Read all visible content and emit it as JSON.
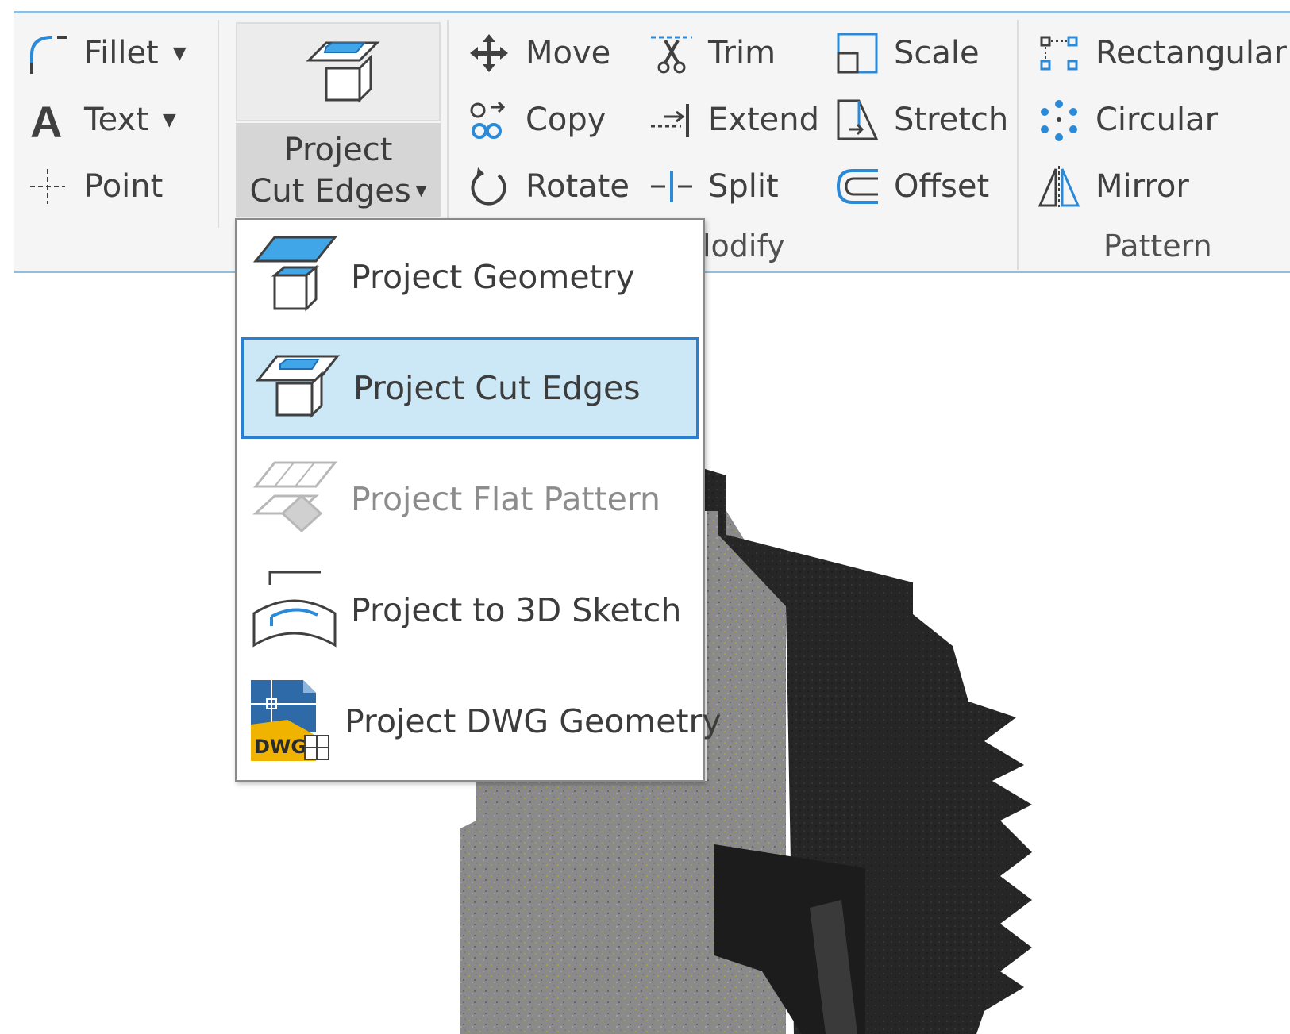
{
  "colors": {
    "accent": "#2b7fd0",
    "selected_bg": "#cce8f6",
    "ribbon_bg": "#f5f5f5",
    "disabled_text": "#8c8c8c",
    "dwg_yellow": "#f0b400",
    "dwg_blue": "#2f6aa8"
  },
  "draw_group": {
    "fillet_label": "Fillet",
    "text_label": "Text",
    "point_label": "Point"
  },
  "project_split": {
    "label_line1": "Project",
    "label_line2": "Cut Edges"
  },
  "modify_group": {
    "move_label": "Move",
    "trim_label": "Trim",
    "scale_label": "Scale",
    "copy_label": "Copy",
    "extend_label": "Extend",
    "stretch_label": "Stretch",
    "rotate_label": "Rotate",
    "split_label": "Split",
    "offset_label": "Offset",
    "group_label_visible": "lodify"
  },
  "pattern_group": {
    "rectangular_label": "Rectangular",
    "circular_label": "Circular",
    "mirror_label": "Mirror",
    "group_label": "Pattern"
  },
  "dropdown": {
    "items": [
      {
        "label": "Project Geometry",
        "icon": "project-geometry-icon",
        "state": "normal"
      },
      {
        "label": "Project Cut Edges",
        "icon": "project-cut-edges-icon",
        "state": "selected"
      },
      {
        "label": "Project Flat Pattern",
        "icon": "project-flat-pattern-icon",
        "state": "disabled"
      },
      {
        "label": "Project to 3D Sketch",
        "icon": "project-to-3d-sketch-icon",
        "state": "normal"
      },
      {
        "label": "Project DWG Geometry",
        "icon": "project-dwg-geometry-icon",
        "state": "normal"
      }
    ],
    "dwg_badge": "DWG"
  }
}
